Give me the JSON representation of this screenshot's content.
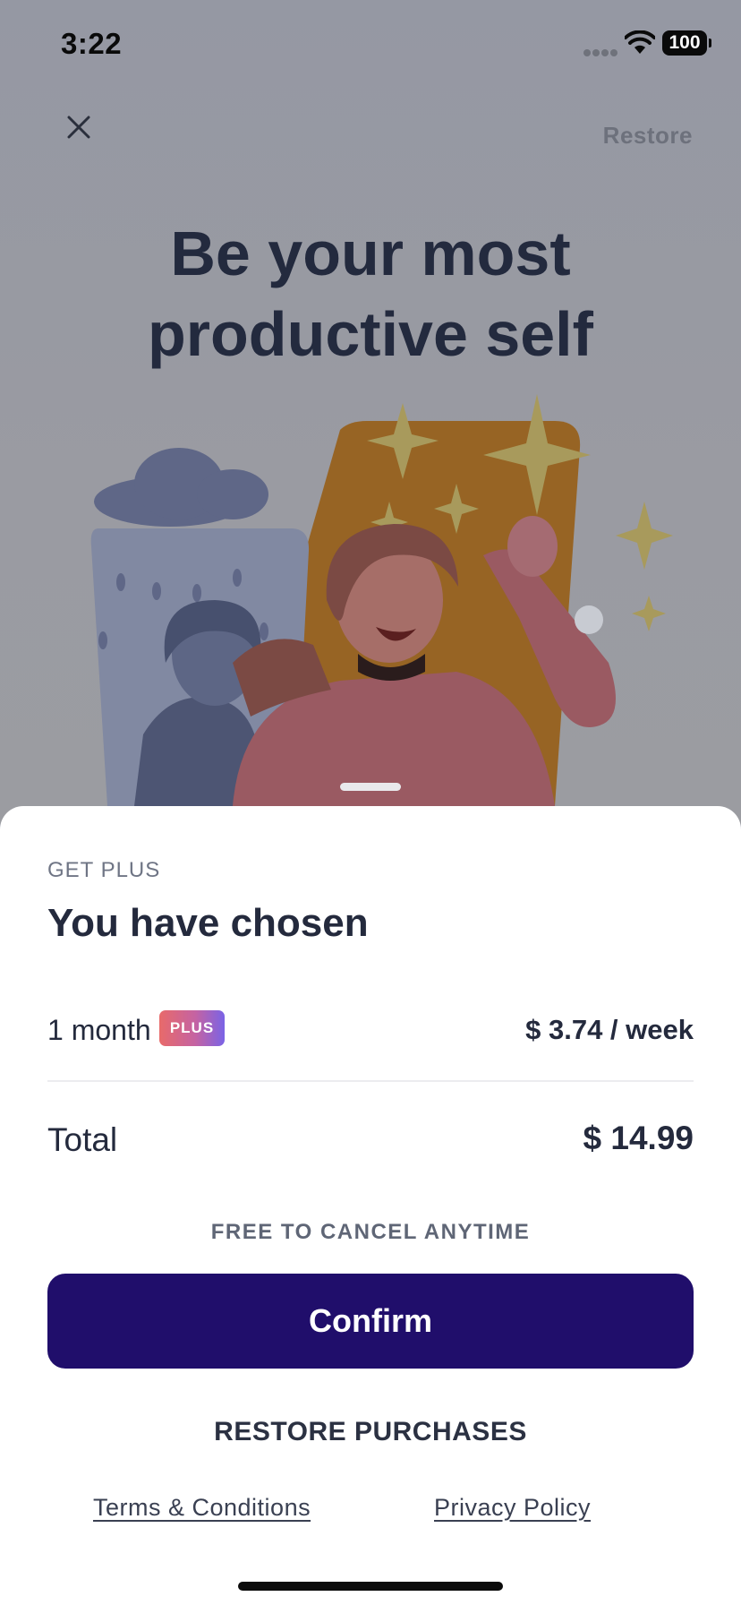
{
  "status_bar": {
    "time": "3:22",
    "battery": "100"
  },
  "header": {
    "restore_label": "Restore"
  },
  "hero": {
    "title": "Be your most productive self"
  },
  "sheet": {
    "eyebrow": "GET PLUS",
    "title": "You have chosen",
    "plan": {
      "name": "1 month",
      "badge": "PLUS",
      "price": "$ 3.74 / week"
    },
    "total": {
      "label": "Total",
      "value": "$ 14.99"
    },
    "cancel_note": "FREE TO CANCEL ANYTIME",
    "confirm_label": "Confirm",
    "restore_purchases_label": "RESTORE PURCHASES",
    "terms_label": "Terms & Conditions",
    "privacy_label": "Privacy Policy"
  },
  "colors": {
    "primary_button": "#200e6b",
    "text_dark": "#242a3d",
    "overlay_background": "#9598a2",
    "badge_gradient_start": "#e86a6a",
    "badge_gradient_end": "#7a63e6"
  }
}
